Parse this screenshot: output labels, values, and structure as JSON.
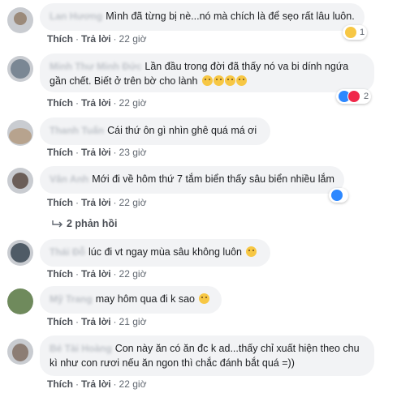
{
  "comments": [
    {
      "name": "Lan Hương",
      "text": "Mình đã từng bị nè...nó mà chích là để sẹo rất lâu luôn.",
      "reaction_count": "1",
      "like": "Thích",
      "reply": "Trả lời",
      "time": "22 giờ"
    },
    {
      "name": "Minh Thư Minh Đức",
      "text": "Lần đầu trong đời đã thấy nó va bi dính ngứa gần chết. Biết ở trên bờ cho lành",
      "reaction_count": "2",
      "like": "Thích",
      "reply": "Trả lời",
      "time": "22 giờ"
    },
    {
      "name": "Thanh Tuấn",
      "text": "Cái thứ ôn gì nhìn ghê quá má ơi",
      "like": "Thích",
      "reply": "Trả lời",
      "time": "23 giờ"
    },
    {
      "name": "Vân Anh",
      "text": "Mới đi về hôm thứ 7 tắm biển thấy sâu biển nhiều lắm",
      "reaction_count": "",
      "like": "Thích",
      "reply": "Trả lời",
      "time": "22 giờ",
      "replies_label": "2 phản hồi"
    },
    {
      "name": "Thái Đỗ",
      "text": "lúc đi vt ngay mùa sâu không luôn",
      "like": "Thích",
      "reply": "Trả lời",
      "time": "22 giờ"
    },
    {
      "name": "Mỹ Trang",
      "text": "may hôm qua đi k sao",
      "like": "Thích",
      "reply": "Trả lời",
      "time": "21 giờ"
    },
    {
      "name": "Bé Tài Hoàng",
      "text": "Con này ăn có ăn đc k ad...thấy chỉ xuất hiện theo chu kì như con rươi nếu ăn ngon thì chắc đánh bắt quá =))",
      "like": "Thích",
      "reply": "Trả lời",
      "time": "22 giờ"
    }
  ],
  "colors": {
    "bubble": "#f2f3f5",
    "like": "#2d88ff",
    "love": "#f0284a",
    "wow": "#f7c744"
  }
}
